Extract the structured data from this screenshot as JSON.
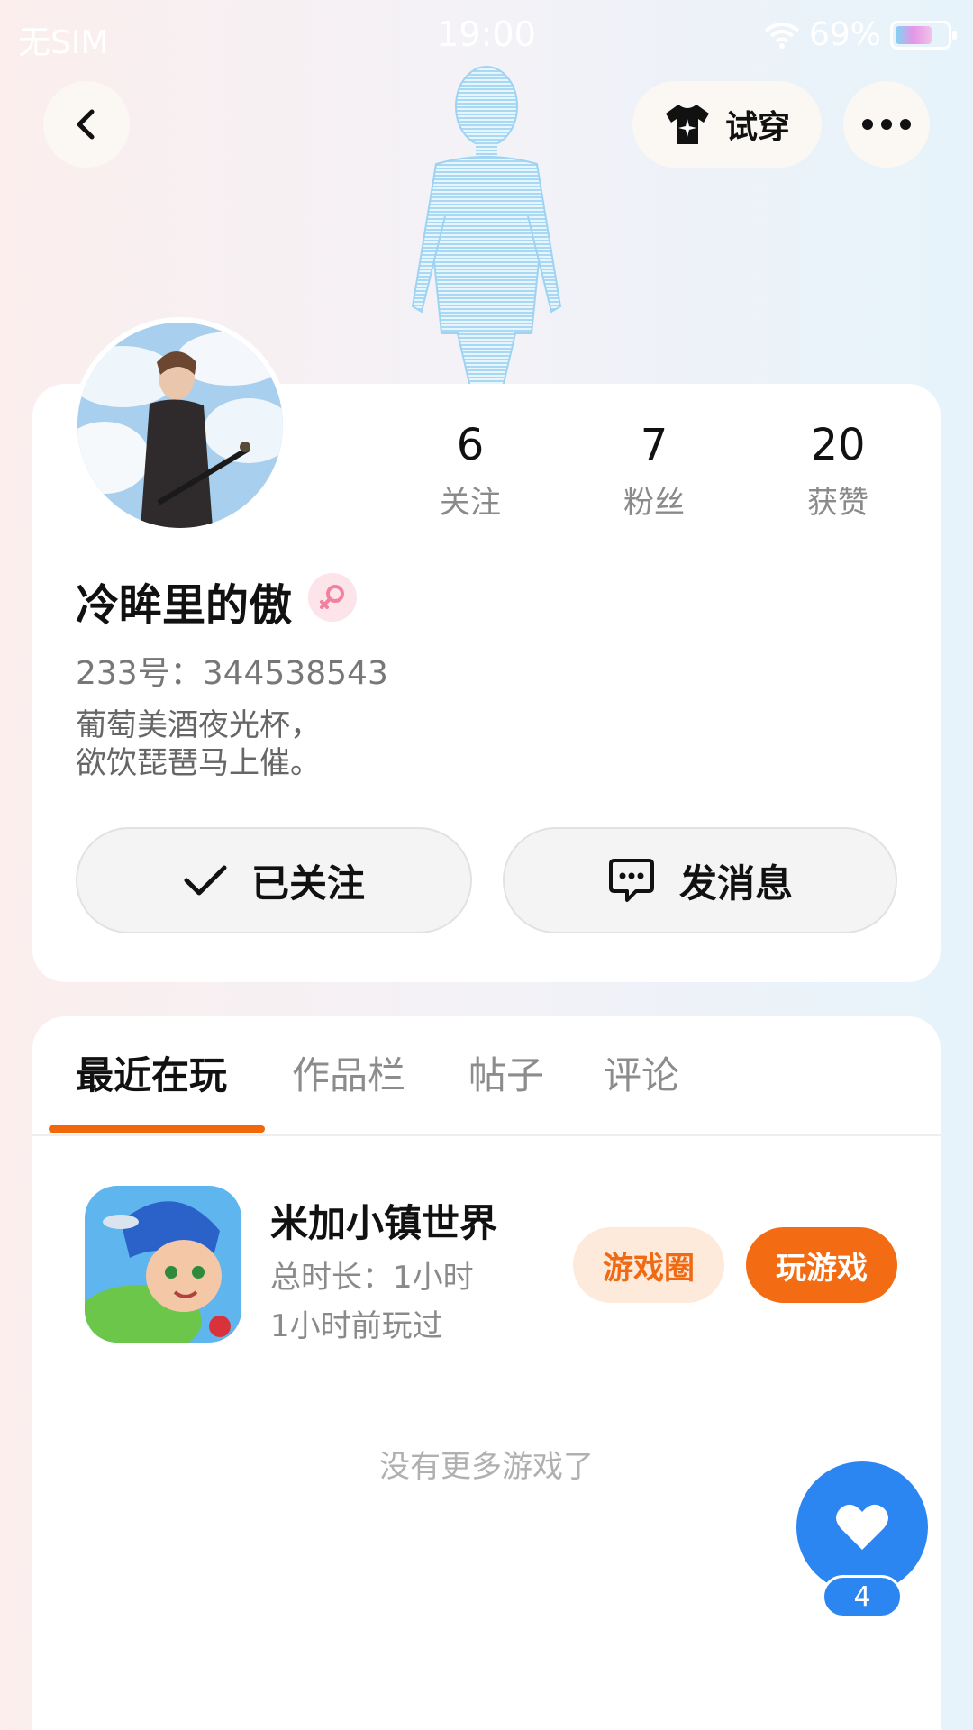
{
  "status_bar": {
    "carrier": "无SIM",
    "time": "19:00",
    "battery": "69%"
  },
  "header": {
    "tryon_label": "试穿",
    "icons": [
      "back-arrow-icon",
      "tshirt-icon",
      "more-icon"
    ]
  },
  "profile": {
    "stats": [
      {
        "value": "6",
        "label": "关注"
      },
      {
        "value": "7",
        "label": "粉丝"
      },
      {
        "value": "20",
        "label": "获赞"
      }
    ],
    "nickname": "冷眸里的傲",
    "gender_icon": "female-icon",
    "uid": "233号：344538543",
    "bio": "葡萄美酒夜光杯，\n欲饮琵琶马上催。",
    "follow_label": "已关注",
    "message_label": "发消息"
  },
  "tabs": [
    {
      "label": "最近在玩",
      "active": true
    },
    {
      "label": "作品栏",
      "active": false
    },
    {
      "label": "帖子",
      "active": false
    },
    {
      "label": "评论",
      "active": false
    }
  ],
  "games": [
    {
      "name": "米加小镇世界",
      "duration": "总时长：1小时",
      "last_played": "1小时前玩过",
      "circle_label": "游戏圈",
      "play_label": "玩游戏"
    }
  ],
  "no_more_text": "没有更多游戏了",
  "like_fab": {
    "count": "4",
    "icon": "heart-icon"
  },
  "colors": {
    "accent": "#f36c13",
    "fab_blue": "#2c86f2",
    "circle_pill_bg": "#fdeadb"
  }
}
